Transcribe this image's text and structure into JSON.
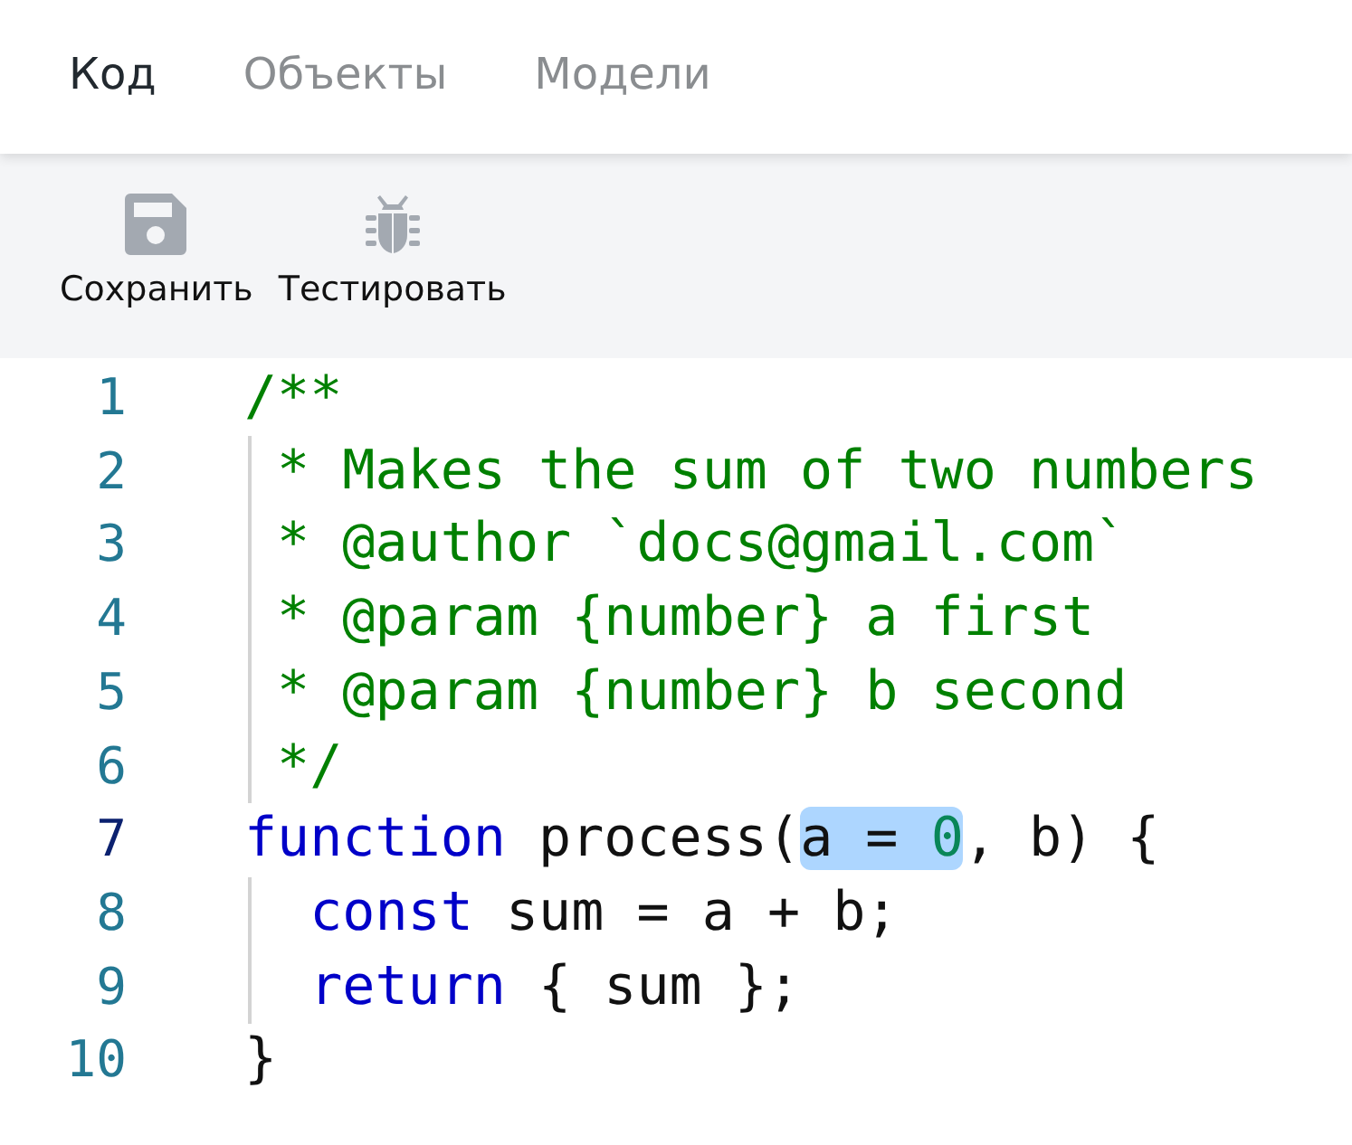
{
  "tabs": [
    {
      "label": "Код",
      "selected": true
    },
    {
      "label": "Объекты",
      "selected": false
    },
    {
      "label": "Модели",
      "selected": false
    }
  ],
  "toolbar": [
    {
      "kind": "save",
      "label": "Сохранить"
    },
    {
      "kind": "test",
      "label": "Тестировать"
    }
  ],
  "editor": {
    "lines": [
      {
        "number": "1",
        "active": false,
        "guide": false,
        "tokens": [
          {
            "text": "/**",
            "kind": "comment",
            "highlighted": false
          }
        ]
      },
      {
        "number": "2",
        "active": false,
        "guide": true,
        "tokens": [
          {
            "text": " * Makes the sum of two numbers",
            "kind": "comment",
            "highlighted": false
          }
        ]
      },
      {
        "number": "3",
        "active": false,
        "guide": true,
        "tokens": [
          {
            "text": " * @author `docs@gmail.com`",
            "kind": "comment",
            "highlighted": false
          }
        ]
      },
      {
        "number": "4",
        "active": false,
        "guide": true,
        "tokens": [
          {
            "text": " * @param {number} a first",
            "kind": "comment",
            "highlighted": false
          }
        ]
      },
      {
        "number": "5",
        "active": false,
        "guide": true,
        "tokens": [
          {
            "text": " * @param {number} b second",
            "kind": "comment",
            "highlighted": false
          }
        ]
      },
      {
        "number": "6",
        "active": false,
        "guide": true,
        "tokens": [
          {
            "text": " */",
            "kind": "comment",
            "highlighted": false
          }
        ]
      },
      {
        "number": "7",
        "active": true,
        "guide": false,
        "tokens": [
          {
            "text": "function",
            "kind": "keyword",
            "highlighted": false
          },
          {
            "text": " process(",
            "kind": "plain",
            "highlighted": false
          },
          {
            "text": "a = ",
            "kind": "plain",
            "highlighted": true
          },
          {
            "text": "0",
            "kind": "number",
            "highlighted": true
          },
          {
            "text": ", b) {",
            "kind": "plain",
            "highlighted": false
          }
        ]
      },
      {
        "number": "8",
        "active": false,
        "guide": true,
        "tokens": [
          {
            "text": "  const",
            "kind": "keyword",
            "highlighted": false
          },
          {
            "text": " sum = a + b;",
            "kind": "plain",
            "highlighted": false
          }
        ]
      },
      {
        "number": "9",
        "active": false,
        "guide": true,
        "tokens": [
          {
            "text": "  return",
            "kind": "keyword",
            "highlighted": false
          },
          {
            "text": " { sum };",
            "kind": "plain",
            "highlighted": false
          }
        ]
      },
      {
        "number": "10",
        "active": false,
        "guide": false,
        "tokens": [
          {
            "text": "}",
            "kind": "plain",
            "highlighted": false
          }
        ]
      }
    ]
  }
}
